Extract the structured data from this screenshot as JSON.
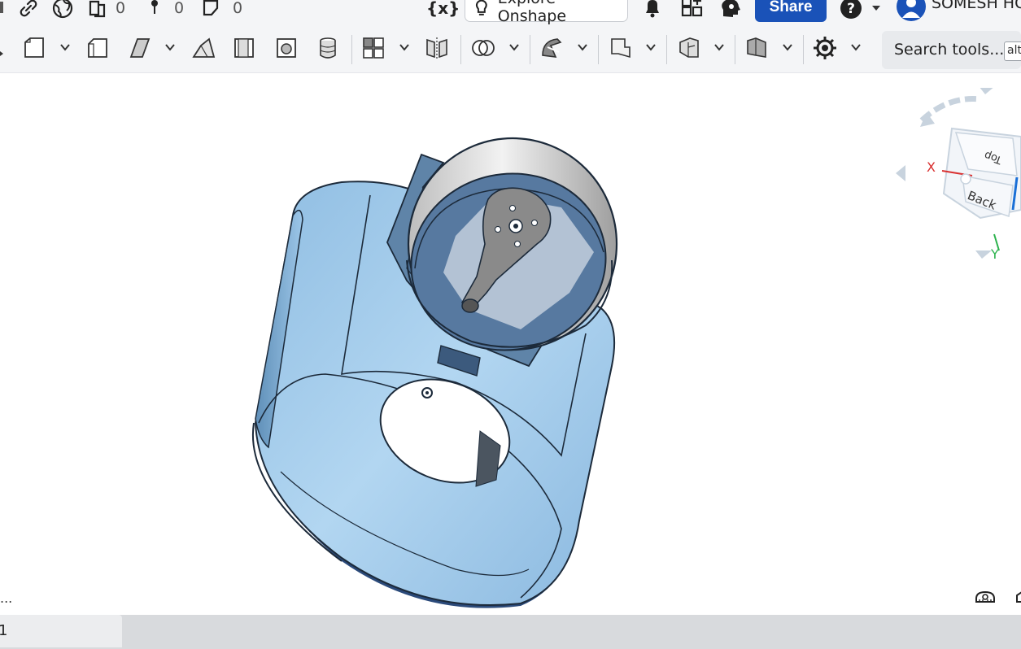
{
  "header": {
    "counts": {
      "versions": "0",
      "comments": "0",
      "branches": "0"
    },
    "variable_label": "{x}",
    "explore_label": "Explore Onshape",
    "share_label": "Share",
    "user_name": "SOMESH HO"
  },
  "toolbar": {
    "search_label": "Search tools...",
    "search_shortcut": "alt"
  },
  "viewcube": {
    "faces": {
      "top": "Top",
      "back": "Back"
    },
    "axes": {
      "x": "X",
      "y": "Y"
    }
  },
  "viewport": {
    "ellipsis": "..."
  },
  "bottom": {
    "tab_label": "1"
  },
  "colors": {
    "share": "#1a52b8",
    "part_blue": "#a8d0ee",
    "part_grey": "#d9d9d9",
    "axis_x": "#d93030",
    "axis_y": "#2bb24c"
  }
}
